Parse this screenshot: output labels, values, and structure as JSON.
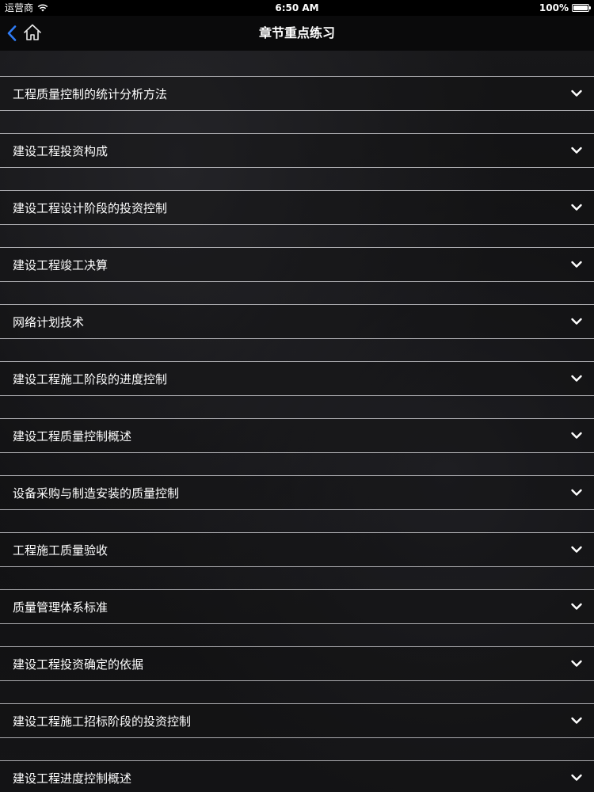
{
  "status_bar": {
    "carrier": "运营商",
    "time": "6:50 AM",
    "battery": "100%"
  },
  "nav_bar": {
    "title": "章节重点练习",
    "back_icon": "chevron-left-icon",
    "home_icon": "home-icon"
  },
  "colors": {
    "accent": "#2f7cf6",
    "separator": "#a9a9ad",
    "text": "#ffffff"
  },
  "chapters": [
    {
      "label": "工程质量控制的统计分析方法"
    },
    {
      "label": "建设工程投资构成"
    },
    {
      "label": "建设工程设计阶段的投资控制"
    },
    {
      "label": "建设工程竣工决算"
    },
    {
      "label": "网络计划技术"
    },
    {
      "label": "建设工程施工阶段的进度控制"
    },
    {
      "label": "建设工程质量控制概述"
    },
    {
      "label": "设备采购与制造安装的质量控制"
    },
    {
      "label": "工程施工质量验收"
    },
    {
      "label": "质量管理体系标准"
    },
    {
      "label": "建设工程投资确定的依据"
    },
    {
      "label": "建设工程施工招标阶段的投资控制"
    },
    {
      "label": "建设工程进度控制概述"
    }
  ]
}
